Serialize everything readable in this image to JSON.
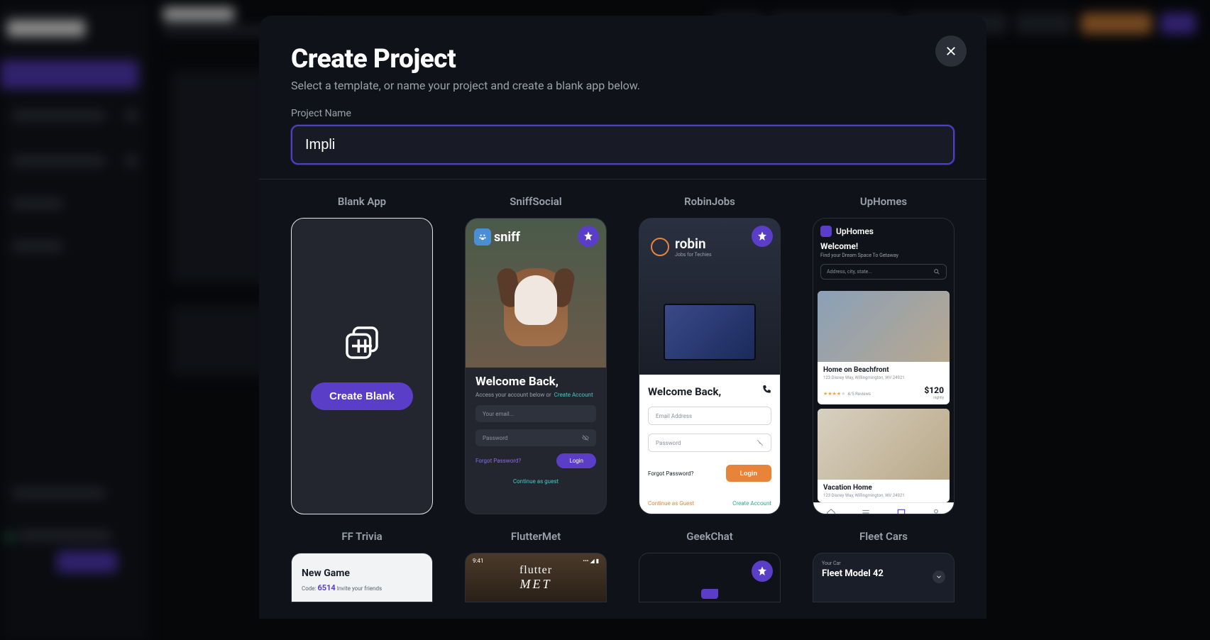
{
  "modal": {
    "title": "Create Project",
    "subtitle": "Select a template, or name your project and create a blank app below.",
    "field_label": "Project Name",
    "name_value": "Impli"
  },
  "templates": [
    {
      "title": "Blank App",
      "create_label": "Create Blank"
    },
    {
      "title": "SniffSocial",
      "brand": "sniff",
      "welcome": "Welcome Back,",
      "sub_prefix": "Access your account below or",
      "create_link": "Create Account",
      "email_ph": "Your email...",
      "password_ph": "Password",
      "forgot": "Forgot Password?",
      "login": "Login",
      "guest": "Continue as guest"
    },
    {
      "title": "RobinJobs",
      "brand": "robin",
      "tagline": "Jobs for Techies",
      "welcome": "Welcome Back,",
      "email_ph": "Email Address",
      "password_ph": "Password",
      "forgot": "Forgot Password?",
      "login": "Login",
      "guest": "Continue as Guest",
      "create": "Create Account"
    },
    {
      "title": "UpHomes",
      "brand": "UpHomes",
      "welcome": "Welcome!",
      "sub": "Find your Dream Space To Getaway",
      "search_ph": "Address, city, state...",
      "listing1": {
        "name": "Home on Beachfront",
        "addr": "123 Disney Way, Willingmington, WV 24921",
        "price": "$120",
        "nightly": "nightly",
        "reviews": "4/5 Reviews"
      },
      "listing2": {
        "name": "Vacation Home",
        "addr": "123 Disney Way, Willingmington, WV 24921"
      }
    }
  ],
  "templates_row2": [
    {
      "title": "FF Trivia",
      "new_game": "New Game",
      "code_label": "Code:",
      "code": "6514",
      "invite": "Invite your friends"
    },
    {
      "title": "FlutterMet",
      "time": "9:41",
      "brand_top": "flutter",
      "brand_bot": "MET"
    },
    {
      "title": "GeekChat"
    },
    {
      "title": "Fleet Cars",
      "your_car": "Your Car",
      "model": "Fleet Model 42"
    }
  ]
}
